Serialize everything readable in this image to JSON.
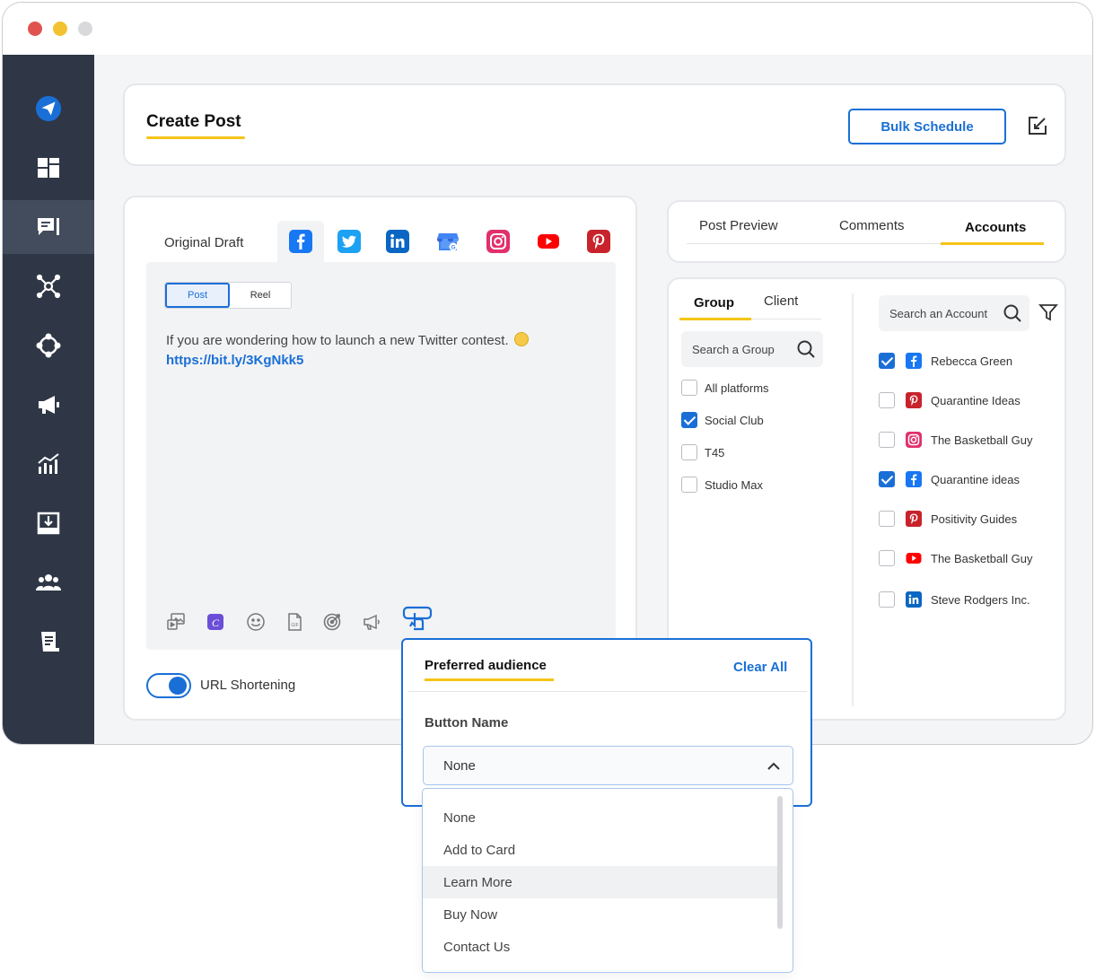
{
  "header": {
    "title": "Create Post",
    "bulk_schedule_label": "Bulk Schedule"
  },
  "editor": {
    "draft_tab_label": "Original Draft",
    "social_tabs": [
      "facebook-icon",
      "twitter-icon",
      "linkedin-icon",
      "google-business-icon",
      "instagram-icon",
      "youtube-icon",
      "pinterest-icon"
    ],
    "post_type": {
      "post_label": "Post",
      "reel_label": "Reel",
      "selected": "Post"
    },
    "post_text": "If you are wondering how to launch a new Twitter contest.",
    "post_link": "https://bit.ly/3KgNkk5",
    "toolbar_icons": [
      "media-library-icon",
      "canva-icon",
      "emoji-icon",
      "gif-icon",
      "target-icon",
      "megaphone-icon",
      "cta-button-icon"
    ],
    "url_shortening": {
      "label": "URL Shortening",
      "enabled": true
    }
  },
  "preview_tabs": {
    "items": [
      "Post Preview",
      "Comments",
      "Accounts"
    ],
    "active": "Accounts"
  },
  "groups": {
    "tabs": [
      "Group",
      "Client"
    ],
    "active_tab": "Group",
    "search_placeholder": "Search a Group",
    "items": [
      {
        "label": "All platforms",
        "checked": false
      },
      {
        "label": "Social Club",
        "checked": true
      },
      {
        "label": "T45",
        "checked": false
      },
      {
        "label": "Studio Max",
        "checked": false
      }
    ]
  },
  "accounts": {
    "search_placeholder": "Search an Account",
    "items": [
      {
        "label": "Rebecca Green",
        "network": "facebook",
        "checked": true
      },
      {
        "label": "Quarantine Ideas",
        "network": "pinterest",
        "checked": false
      },
      {
        "label": "The Basketball Guy",
        "network": "instagram",
        "checked": false
      },
      {
        "label": "Quarantine ideas",
        "network": "facebook",
        "checked": true
      },
      {
        "label": "Positivity Guides",
        "network": "pinterest",
        "checked": false
      },
      {
        "label": "The Basketball Guy",
        "network": "youtube",
        "checked": false
      },
      {
        "label": "Steve Rodgers Inc.",
        "network": "linkedin",
        "checked": false
      }
    ]
  },
  "audience_popup": {
    "title": "Preferred audience",
    "clear_all_label": "Clear All",
    "button_name_label": "Button Name",
    "selected_value": "None",
    "options": [
      "None",
      "Add to Card",
      "Learn More",
      "Buy Now",
      "Contact Us"
    ],
    "hovered_option": "Learn More"
  },
  "colors": {
    "accent": "#1a6fd6",
    "highlight": "#f5c518",
    "sidebar": "#2f3746"
  }
}
